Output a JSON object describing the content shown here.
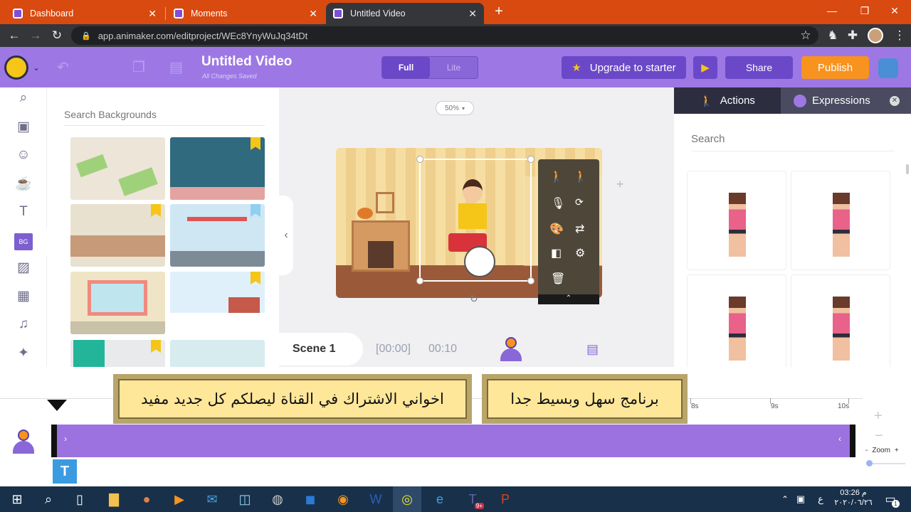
{
  "browser": {
    "tabs": [
      {
        "title": "Dashboard"
      },
      {
        "title": "Moments"
      },
      {
        "title": "Untitled Video"
      }
    ],
    "new_tab": "+",
    "url": "app.animaker.com/editproject/WEc8YnyWuJq34tDt"
  },
  "header": {
    "title": "Untitled Video",
    "subtitle": "All Changes Saved",
    "mode_full": "Full",
    "mode_lite": "Lite",
    "upgrade": "Upgrade to starter",
    "share": "Share",
    "publish": "Publish"
  },
  "bg_panel": {
    "search_placeholder": "Search Backgrounds",
    "rail_bg_label": "BG"
  },
  "canvas": {
    "zoom": "50%",
    "scene": "Scene 1",
    "time_start": "[00:00]",
    "time_end": "00:10"
  },
  "right_panel": {
    "tab_actions": "Actions",
    "tab_expressions": "Expressions",
    "search_placeholder": "Search"
  },
  "timeline": {
    "ticks": [
      "8s",
      "9s",
      "10s"
    ],
    "zoom_label": "Zoom",
    "zoom_minus": "-",
    "zoom_plus": "+",
    "text_track": "T"
  },
  "overlay": {
    "banner_left": "اخواني الاشتراك في القناة ليصلكم كل جديد مفيد",
    "banner_right": "برنامج سهل وبسيط جدا"
  },
  "taskbar": {
    "time": "03:26 م",
    "date": "٢٠٢٠/٠٦/٢٦",
    "lang": "ع",
    "notif_count": "1",
    "teams_badge": "9+"
  },
  "colors": {
    "accent": "#9d78e5",
    "publish": "#f7931e",
    "tab_bar": "#d94a10"
  }
}
